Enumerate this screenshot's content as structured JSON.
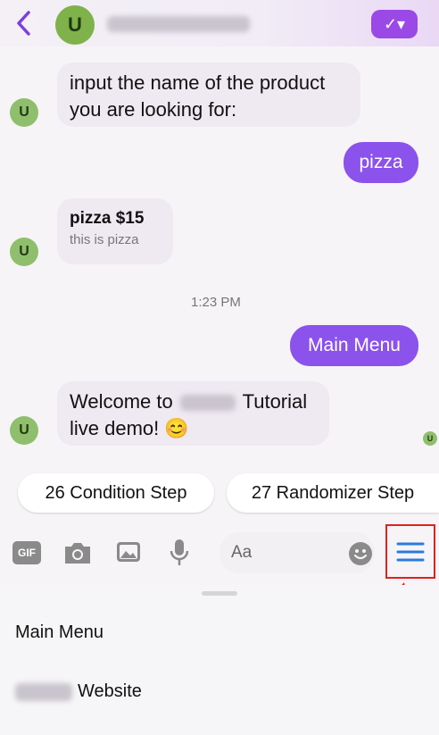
{
  "header": {
    "avatar_letter": "U",
    "action_icon": "check-dropdown-icon",
    "accent_color": "#9a49e6"
  },
  "messages": [
    {
      "from": "bot",
      "lines": [
        "input the name of the product",
        "you are looking for:"
      ]
    },
    {
      "from": "user",
      "text": "pizza"
    },
    {
      "from": "bot",
      "title": "pizza $15",
      "subtitle": "this is pizza"
    },
    {
      "timestamp": "1:23 PM"
    },
    {
      "from": "user",
      "text": "Main Menu"
    },
    {
      "from": "bot",
      "line1_prefix": "Welcome to",
      "line1_suffix": "Tutorial",
      "line2": "live demo! 😊"
    }
  ],
  "avatar_letter": "U",
  "quick_replies": [
    "26 Condition Step",
    "27 Randomizer Step"
  ],
  "composer": {
    "gif_label": "GIF",
    "placeholder": "Aa",
    "icons": [
      "gif-icon",
      "camera-icon",
      "image-icon",
      "microphone-icon",
      "emoji-icon",
      "menu-icon"
    ]
  },
  "persistent_menu": {
    "items": [
      {
        "label": "Main Menu"
      },
      {
        "label": "Website"
      }
    ]
  }
}
